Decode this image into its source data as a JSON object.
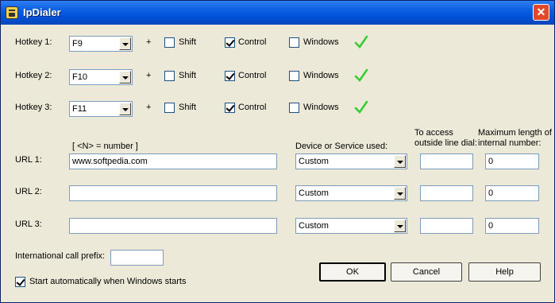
{
  "window": {
    "title": "IpDialer",
    "close": "✕"
  },
  "hotkeys": [
    {
      "label": "Hotkey 1:",
      "key": "F9",
      "plus": "+",
      "shift": {
        "label": "Shift",
        "checked": false
      },
      "control": {
        "label": "Control",
        "checked": true
      },
      "windows": {
        "label": "Windows",
        "checked": false
      }
    },
    {
      "label": "Hotkey 2:",
      "key": "F10",
      "plus": "+",
      "shift": {
        "label": "Shift",
        "checked": false
      },
      "control": {
        "label": "Control",
        "checked": true
      },
      "windows": {
        "label": "Windows",
        "checked": false
      }
    },
    {
      "label": "Hotkey 3:",
      "key": "F11",
      "plus": "+",
      "shift": {
        "label": "Shift",
        "checked": false
      },
      "control": {
        "label": "Control",
        "checked": true
      },
      "windows": {
        "label": "Windows",
        "checked": false
      }
    }
  ],
  "headers": {
    "number_hint": "[ <N> = number ]",
    "device": "Device or Service used:",
    "access_1": "To access",
    "access_2": "outside line dial:",
    "maxlen_1": "Maximum length of",
    "maxlen_2": "internal number:"
  },
  "urls": [
    {
      "label": "URL 1:",
      "value": "www.softpedia.com",
      "device": "Custom",
      "access": "",
      "maxlen": "0"
    },
    {
      "label": "URL 2:",
      "value": "",
      "device": "Custom",
      "access": "",
      "maxlen": "0"
    },
    {
      "label": "URL 3:",
      "value": "",
      "device": "Custom",
      "access": "",
      "maxlen": "0"
    }
  ],
  "intl": {
    "label": "International call prefix:",
    "value": ""
  },
  "autostart": {
    "label": "Start automatically when Windows starts",
    "checked": true
  },
  "buttons": {
    "ok": "OK",
    "cancel": "Cancel",
    "help": "Help"
  },
  "colors": {
    "titlebar": "#0a5ee0",
    "dialog": "#ece9d8",
    "check": "#33cc33"
  }
}
